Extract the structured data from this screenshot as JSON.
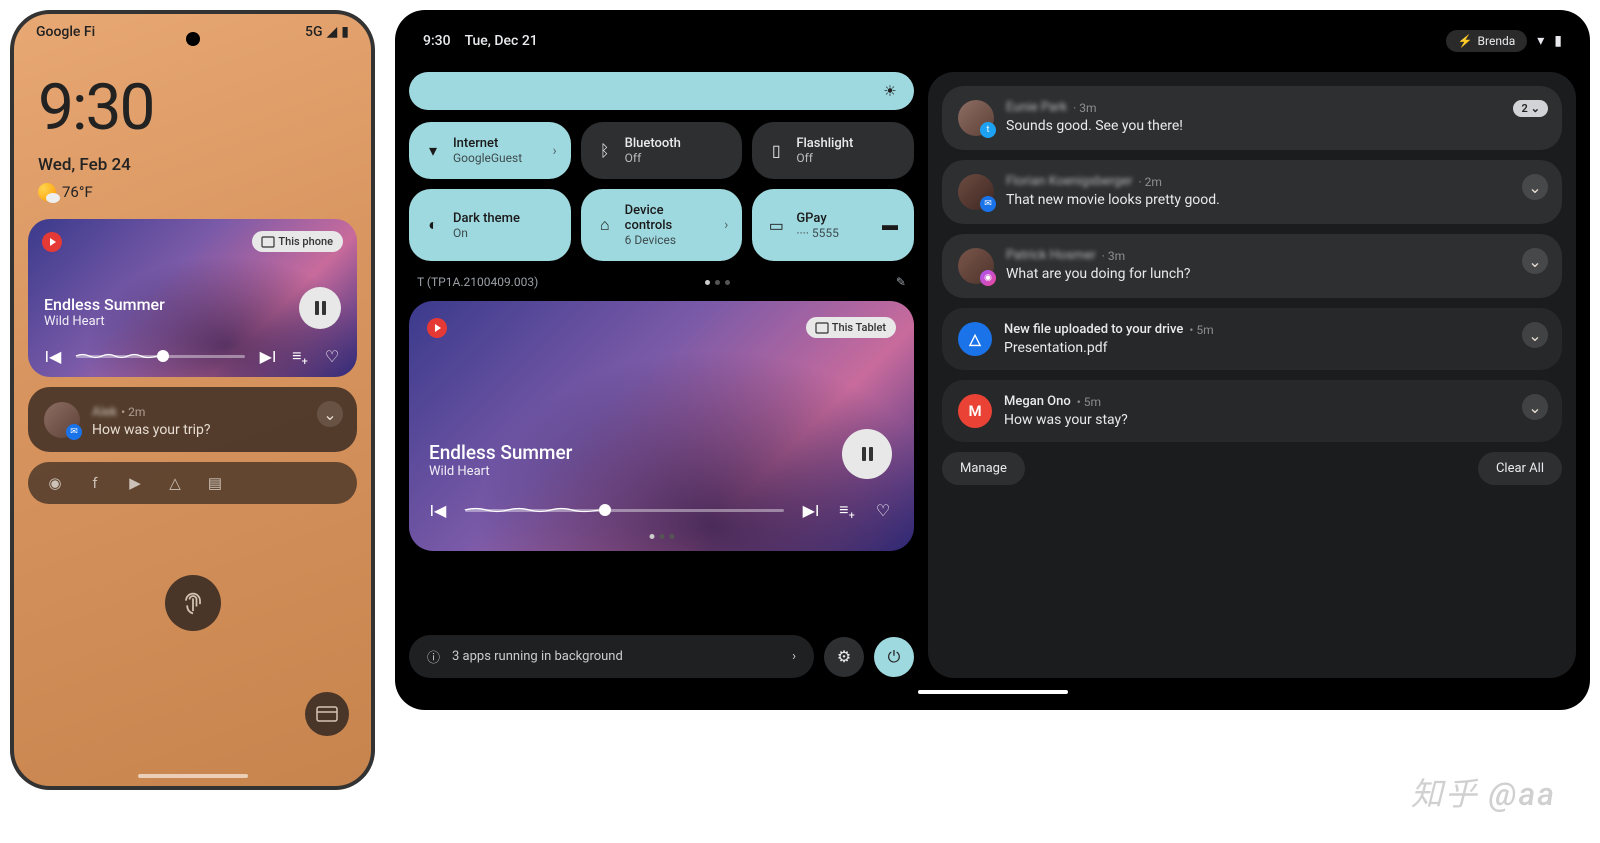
{
  "phone": {
    "carrier": "Google Fi",
    "signal": "5G",
    "clock": "9:30",
    "date": "Wed, Feb 24",
    "temp": "76°F",
    "media": {
      "cast": "This phone",
      "title": "Endless Summer",
      "artist": "Wild Heart"
    },
    "notif": {
      "name": "Alek",
      "time": "• 2m",
      "msg": "How was your trip?"
    }
  },
  "tablet": {
    "clock": "9:30",
    "date": "Tue, Dec 21",
    "user": "Brenda",
    "tiles": {
      "internet": {
        "label": "Internet",
        "sub": "GoogleGuest"
      },
      "bluetooth": {
        "label": "Bluetooth",
        "sub": "Off"
      },
      "flashlight": {
        "label": "Flashlight",
        "sub": "Off"
      },
      "darktheme": {
        "label": "Dark theme",
        "sub": "On"
      },
      "devices": {
        "label": "Device controls",
        "sub": "6 Devices"
      },
      "gpay": {
        "label": "GPay",
        "sub": "···· 5555"
      }
    },
    "build": "T (TP1A.2100409.003)",
    "media": {
      "cast": "This Tablet",
      "title": "Endless Summer",
      "artist": "Wild Heart"
    },
    "bg_apps": "3 apps running in background",
    "notifs": [
      {
        "name": "Eunie Park",
        "time": "· 3m",
        "msg": "Sounds good. See you there!",
        "count": "2"
      },
      {
        "name": "Florian Koenigsberger",
        "time": "· 2m",
        "msg": "That new movie looks pretty good."
      },
      {
        "name": "Patrick Hosmer",
        "time": "· 3m",
        "msg": "What are you doing for lunch?"
      },
      {
        "title": "New file uploaded to your drive",
        "time": "• 5m",
        "msg": "Presentation.pdf"
      },
      {
        "name": "Megan Ono",
        "time": "• 5m",
        "msg": "How was your stay?"
      }
    ],
    "manage": "Manage",
    "clear": "Clear All"
  },
  "watermark": "知乎 @aa"
}
